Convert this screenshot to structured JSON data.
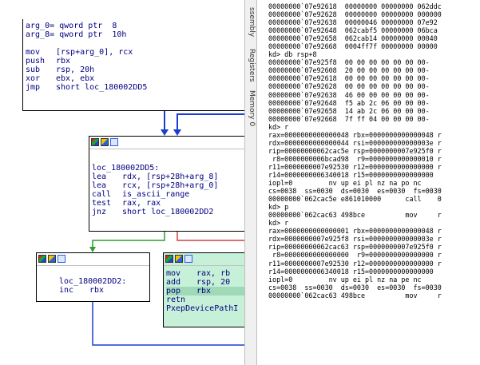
{
  "graph": {
    "node_top": [
      {
        "m": "arg_0= qword ptr  8",
        "o": ""
      },
      {
        "m": "arg_8= qword ptr  10h",
        "o": ""
      },
      {
        "m": "",
        "o": ""
      },
      {
        "m": "mov",
        "o": "[rsp+arg_0], rcx"
      },
      {
        "m": "push",
        "o": "rbx"
      },
      {
        "m": "sub",
        "o": "rsp, 20h"
      },
      {
        "m": "xor",
        "o": "ebx, ebx"
      },
      {
        "m": "jmp",
        "o": "short loc_180002DD5"
      }
    ],
    "node_mid": [
      {
        "m": "loc_180002DD5:",
        "o": ""
      },
      {
        "m": "lea",
        "o": "rdx, [rsp+28h+arg_8]"
      },
      {
        "m": "lea",
        "o": "rcx, [rsp+28h+arg_0]"
      },
      {
        "m": "call",
        "o": "is_ascii_range"
      },
      {
        "m": "test",
        "o": "rax, rax"
      },
      {
        "m": "jnz",
        "o": "short loc_180002DD2"
      }
    ],
    "node_left": [
      {
        "m": "loc_180002DD2:",
        "o": ""
      },
      {
        "m": "inc",
        "o": "rbx"
      }
    ],
    "node_right": [
      {
        "m": "mov",
        "o": "rax, rb"
      },
      {
        "m": "add",
        "o": "rsp, 20"
      },
      {
        "m": "pop",
        "o": "rbx"
      },
      {
        "m": "retn",
        "o": ""
      },
      {
        "m": "PxepDevicePathI",
        "o": ""
      }
    ]
  },
  "tabs": {
    "disassembly": "ssembly",
    "registers": "Registers",
    "memory": "Memory 0"
  },
  "console": {
    "lines": [
      "00000000`07e92618  00000000 00000000 062ddc",
      "00000000`07e92628  00000000 00000000 000000",
      "00000000`07e92638  00000046 00000000 07e92",
      "00000000`07e92648  062cabf5 00000000 06bca",
      "00000000`07e92658  062cab14 00000000 00040",
      "00000000`07e92668  0004ff7f 00000000 00000",
      "kd> db rsp+8",
      "00000000`07e925f8  00 00 00 00 00 00 00-",
      "00000000`07e92608  20 00 00 00 00 00 00-",
      "00000000`07e92618  00 00 00 00 00 00 00-",
      "00000000`07e92628  00 00 00 00 00 00 00-",
      "00000000`07e92638  46 00 00 00 00 00 00-",
      "00000000`07e92648  f5 ab 2c 06 00 00 00-",
      "00000000`07e92658  14 ab 2c 06 00 00 00-",
      "00000000`07e92668  7f ff 04 00 00 00 00-",
      "kd> r",
      "rax=0000000000000048 rbx=0000000000000048 r",
      "rdx=0000000000000044 rsi=000000000000003e r",
      "rip=00000000062cac5e rsp=0000000007e925f0 r",
      " r8=0000000006bcad98  r9=0000000000000010 r",
      "r11=0000000007e92530 r12=0000000000000000 r",
      "r14=0000000006340018 r15=0000000000000000",
      "iopl=0         nv up ei pl nz na po nc",
      "cs=0038  ss=0030  ds=0030  es=0030  fs=0030",
      "00000000`062cac5e e861010000      call    0",
      "kd> p",
      "00000000`062cac63 498bce          mov     r",
      "kd> r",
      "rax=0000000000000001 rbx=0000000000000048 r",
      "rdx=0000000007e925f8 rsi=000000000000003e r",
      "rip=00000000062cac63 rsp=0000000007e925f0 r",
      " r8=0000000000000000  r9=0000000000000000 r",
      "r11=0000000007e92530 r12=0000000000000000 r",
      "r14=0000000006340018 r15=0000000000000000",
      "iopl=0         nv up ei pl nz na pe nc",
      "cs=0038  ss=0030  ds=0030  es=0030  fs=0030",
      "00000000`062cac63 498bce          mov     r"
    ]
  },
  "colors": {
    "edge_blue": "#1a3fd0",
    "edge_green": "#2e9e2e",
    "edge_red": "#d04040",
    "highlight": "#c7f0d8"
  }
}
